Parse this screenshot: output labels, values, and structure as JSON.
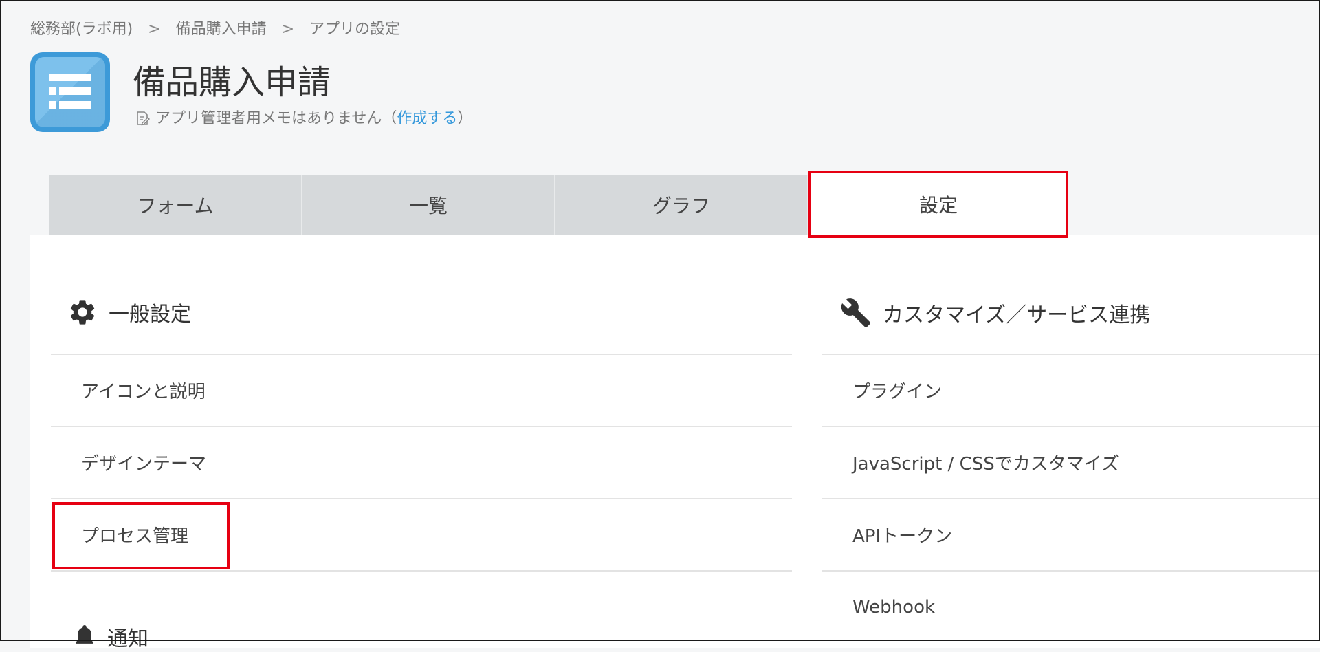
{
  "breadcrumb": {
    "items": [
      "総務部(ラボ用)",
      "備品購入申請",
      "アプリの設定"
    ],
    "separator": ">"
  },
  "header": {
    "title": "備品購入申請",
    "memo_text": "アプリ管理者用メモはありません",
    "memo_open": "（",
    "memo_link": "作成する",
    "memo_close": "）"
  },
  "tabs": [
    {
      "label": "フォーム",
      "active": false
    },
    {
      "label": "一覧",
      "active": false
    },
    {
      "label": "グラフ",
      "active": false
    },
    {
      "label": "設定",
      "active": true
    }
  ],
  "general": {
    "heading": "一般設定",
    "items": [
      "アイコンと説明",
      "デザインテーマ",
      "プロセス管理"
    ]
  },
  "notify": {
    "heading": "通知"
  },
  "custom": {
    "heading": "カスタマイズ／サービス連携",
    "items": [
      "プラグイン",
      "JavaScript / CSSでカスタマイズ",
      "APIトークン",
      "Webhook"
    ]
  },
  "colors": {
    "highlight": "#e60012",
    "link": "#3498db",
    "app_icon": "#3d9ad8"
  }
}
